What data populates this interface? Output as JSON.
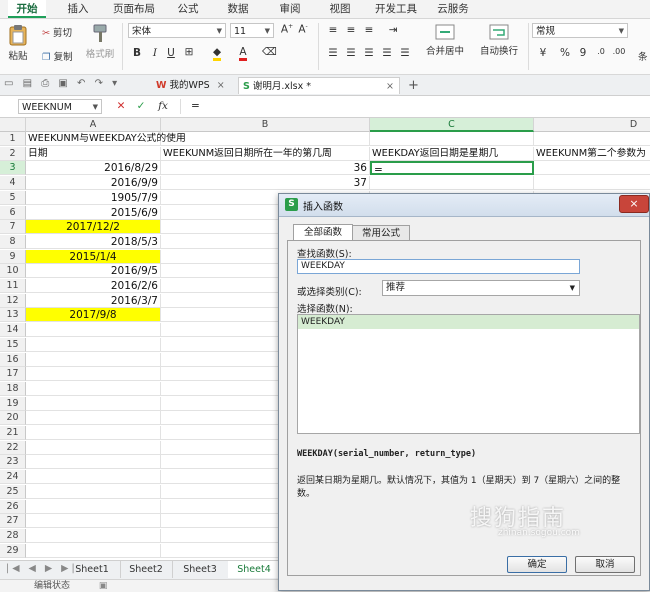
{
  "menu": {
    "tabs": [
      "开始",
      "插入",
      "页面布局",
      "公式",
      "数据",
      "审阅",
      "视图",
      "开发工具",
      "云服务"
    ],
    "active": "开始"
  },
  "ribbon": {
    "paste": "粘贴",
    "cut": "剪切",
    "copy": "复制",
    "format_painter": "格式刷",
    "font_name": "宋体",
    "font_size": "11",
    "merge_center": "合并居中",
    "wrap_text": "自动换行",
    "number_format": "常规",
    "percent": "%",
    "comma": "9",
    "more": "条"
  },
  "tabbar": {
    "wps_tab": "我的WPS",
    "file_tab": "谢明月.xlsx *",
    "new_tab": "+"
  },
  "formula_bar": {
    "name_box": "WEEKNUM",
    "fx": "fx",
    "content": "="
  },
  "columns": [
    "A",
    "B",
    "C",
    "D"
  ],
  "selected_column": "C",
  "selected_row": "3",
  "rows": [
    {
      "n": "1",
      "a": "WEEKUNM与WEEKDAY公式的使用",
      "b": "",
      "c": "",
      "d": ""
    },
    {
      "n": "2",
      "a": "日期",
      "b": "WEEKUNM返回日期所在一年的第几周",
      "c": "WEEKDAY返回日期是星期几",
      "d": "WEEKUNM第二个参数为"
    },
    {
      "n": "3",
      "a": "2016/8/29",
      "b": "36",
      "c": "=",
      "d": ""
    },
    {
      "n": "4",
      "a": "2016/9/9",
      "b": "37",
      "c": "",
      "d": ""
    },
    {
      "n": "5",
      "a": "1905/7/9",
      "b": "",
      "c": "",
      "d": ""
    },
    {
      "n": "6",
      "a": "2015/6/9",
      "b": "",
      "c": "",
      "d": ""
    },
    {
      "n": "7",
      "a": "2017/12/2",
      "b": "",
      "c": "",
      "d": "",
      "yellow": true
    },
    {
      "n": "8",
      "a": "2018/5/3",
      "b": "",
      "c": "",
      "d": ""
    },
    {
      "n": "9",
      "a": "2015/1/4",
      "b": "",
      "c": "",
      "d": "",
      "yellow": true
    },
    {
      "n": "10",
      "a": "2016/9/5",
      "b": "",
      "c": "",
      "d": ""
    },
    {
      "n": "11",
      "a": "2016/2/6",
      "b": "",
      "c": "",
      "d": ""
    },
    {
      "n": "12",
      "a": "2016/3/7",
      "b": "",
      "c": "",
      "d": ""
    },
    {
      "n": "13",
      "a": "2017/9/8",
      "b": "",
      "c": "",
      "d": "",
      "yellow": true
    },
    {
      "n": "14"
    },
    {
      "n": "15"
    },
    {
      "n": "16"
    },
    {
      "n": "17"
    },
    {
      "n": "18"
    },
    {
      "n": "19"
    },
    {
      "n": "20"
    },
    {
      "n": "21"
    },
    {
      "n": "22"
    },
    {
      "n": "23"
    },
    {
      "n": "24"
    },
    {
      "n": "25"
    },
    {
      "n": "26"
    },
    {
      "n": "27"
    },
    {
      "n": "28"
    },
    {
      "n": "29"
    }
  ],
  "sheets": [
    "Sheet1",
    "Sheet2",
    "Sheet3",
    "Sheet4"
  ],
  "active_sheet": "Sheet4",
  "status": "编辑状态",
  "dialog": {
    "title": "插入函数",
    "tabs": [
      "全部函数",
      "常用公式"
    ],
    "search_label": "查找函数(S):",
    "search_value": "WEEKDAY",
    "category_label": "或选择类别(C):",
    "category_value": "推荐",
    "select_label": "选择函数(N):",
    "functions": [
      "WEEKDAY"
    ],
    "signature": "WEEKDAY(serial_number, return_type)",
    "description": "返回某日期为星期几。默认情况下，其值为 1（星期天）到 7（星期六）之间的整数。",
    "ok": "确定",
    "cancel": "取消",
    "close": "×"
  },
  "watermark": {
    "text": "搜狗指南",
    "url": "zhinan.sogou.com"
  },
  "colors": {
    "accent": "#1fa05a",
    "highlight": "#ffff00",
    "close_red": "#c8453a"
  }
}
